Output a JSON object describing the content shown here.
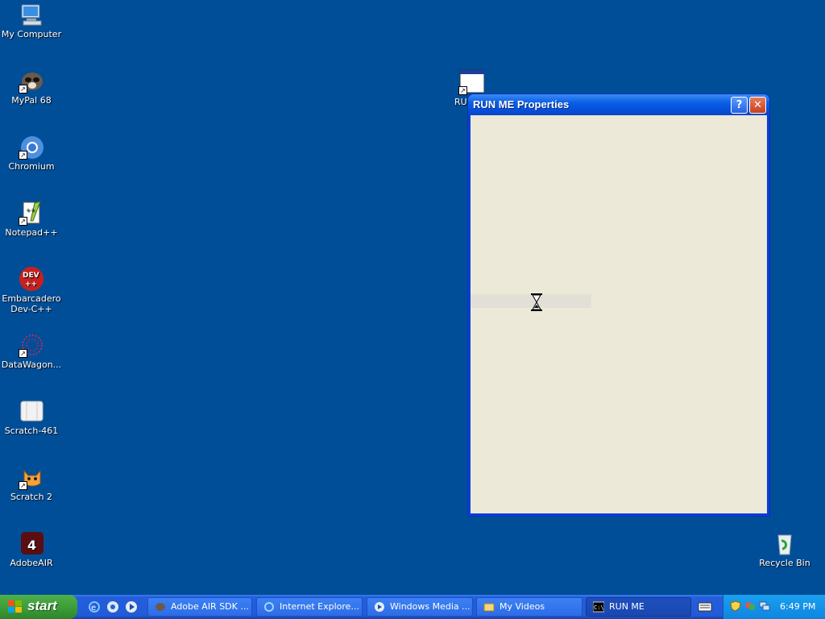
{
  "desktop": {
    "icons": [
      {
        "label": "My Computer",
        "icon": "my-computer-icon",
        "shortcut": false
      },
      {
        "label": "MyPal 68",
        "icon": "mypal-icon",
        "shortcut": true
      },
      {
        "label": "Chromium",
        "icon": "chromium-icon",
        "shortcut": true
      },
      {
        "label": "Notepad++",
        "icon": "notepadpp-icon",
        "shortcut": true
      },
      {
        "label": "Embarcadero Dev-C++",
        "icon": "devcpp-icon",
        "shortcut": false
      },
      {
        "label": "DataWagon...",
        "icon": "datawagon-icon",
        "shortcut": true
      },
      {
        "label": "Scratch-461",
        "icon": "scratch-folder-icon",
        "shortcut": false
      },
      {
        "label": "Scratch 2",
        "icon": "scratch-cat-icon",
        "shortcut": true
      },
      {
        "label": "AdobeAIR",
        "icon": "adobe-air-icon",
        "shortcut": false
      }
    ],
    "run_me_icon_label": "RU",
    "recycle_bin_label": "Recycle Bin"
  },
  "window": {
    "title": "RUN ME Properties",
    "help_glyph": "?",
    "close_glyph": "✕"
  },
  "taskbar": {
    "start_label": "start",
    "tasks": [
      {
        "label": "Adobe AIR SDK ...",
        "icon": "air-sdk-icon",
        "active": false
      },
      {
        "label": "Internet Explore...",
        "icon": "ie-icon",
        "active": false
      },
      {
        "label": "Windows Media ...",
        "icon": "media-player-icon",
        "active": false
      },
      {
        "label": "My Videos",
        "icon": "folder-icon",
        "active": false
      },
      {
        "label": "RUN ME",
        "icon": "console-icon",
        "active": true
      }
    ],
    "clock": "6:49 PM"
  },
  "colors": {
    "desktop": "#004e98",
    "taskbar": "#245edb",
    "start": "#3a9a36",
    "tray": "#0f85e0",
    "window_client": "#ece9d8"
  }
}
